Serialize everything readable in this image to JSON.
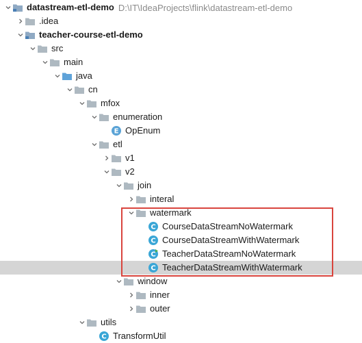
{
  "project": {
    "title": "datastream-etl-demo",
    "path": "D:\\IT\\IdeaProjects\\flink\\datastream-etl-demo"
  },
  "colors": {
    "folder": "#aeb9c1",
    "folder_module": "#8fa9c3",
    "source_folder": "#5fa3d9",
    "class_badge": "#3aa6d6",
    "enum_badge": "#5aa3d6",
    "selection": "#d5d5d5",
    "highlight_border": "#d9443d"
  },
  "tree": [
    {
      "name": "node-datastream-etl-demo",
      "label": "datastream-etl-demo",
      "bold": true,
      "path": "D:\\IT\\IdeaProjects\\flink\\datastream-etl-demo",
      "arrow": "down",
      "icon": "module-folder-icon",
      "indent": 0
    },
    {
      "name": "node-idea",
      "label": ".idea",
      "arrow": "right",
      "icon": "folder-icon",
      "indent": 1
    },
    {
      "name": "node-teacher-course-etl-demo",
      "label": "teacher-course-etl-demo",
      "bold": true,
      "arrow": "down",
      "icon": "module-folder-icon",
      "indent": 1
    },
    {
      "name": "node-src",
      "label": "src",
      "arrow": "down",
      "icon": "folder-icon",
      "indent": 2
    },
    {
      "name": "node-main",
      "label": "main",
      "arrow": "down",
      "icon": "folder-icon",
      "indent": 3
    },
    {
      "name": "node-java",
      "label": "java",
      "arrow": "down",
      "icon": "source-folder-icon",
      "indent": 4
    },
    {
      "name": "node-cn",
      "label": "cn",
      "arrow": "down",
      "icon": "package-icon",
      "indent": 5
    },
    {
      "name": "node-mfox",
      "label": "mfox",
      "arrow": "down",
      "icon": "package-icon",
      "indent": 6
    },
    {
      "name": "node-enumeration",
      "label": "enumeration",
      "arrow": "down",
      "icon": "package-icon",
      "indent": 7
    },
    {
      "name": "node-openum",
      "label": "OpEnum",
      "arrow": "none",
      "icon": "enum-icon",
      "indent": 8
    },
    {
      "name": "node-etl",
      "label": "etl",
      "arrow": "down",
      "icon": "package-icon",
      "indent": 7
    },
    {
      "name": "node-v1",
      "label": "v1",
      "arrow": "right",
      "icon": "package-icon",
      "indent": 8
    },
    {
      "name": "node-v2",
      "label": "v2",
      "arrow": "down",
      "icon": "package-icon",
      "indent": 8
    },
    {
      "name": "node-join",
      "label": "join",
      "arrow": "down",
      "icon": "package-icon",
      "indent": 9
    },
    {
      "name": "node-interal",
      "label": "interal",
      "arrow": "right",
      "icon": "package-icon",
      "indent": 10
    },
    {
      "name": "node-watermark",
      "label": "watermark",
      "arrow": "down",
      "icon": "package-icon",
      "indent": 10
    },
    {
      "name": "node-course-no-watermark",
      "label": "CourseDataStreamNoWatermark",
      "arrow": "none",
      "icon": "class-icon",
      "indent": 11
    },
    {
      "name": "node-course-with-watermark",
      "label": "CourseDataStreamWithWatermark",
      "arrow": "none",
      "icon": "class-icon",
      "indent": 11
    },
    {
      "name": "node-teacher-no-watermark",
      "label": "TeacherDataStreamNoWatermark",
      "arrow": "none",
      "icon": "runnable-class-icon",
      "indent": 11
    },
    {
      "name": "node-teacher-with-watermark",
      "label": "TeacherDataStreamWithWatermark",
      "arrow": "none",
      "icon": "class-icon",
      "indent": 11,
      "selected": true
    },
    {
      "name": "node-window",
      "label": "window",
      "arrow": "down",
      "icon": "package-icon",
      "indent": 9
    },
    {
      "name": "node-inner",
      "label": "inner",
      "arrow": "right",
      "icon": "package-icon",
      "indent": 10
    },
    {
      "name": "node-outer",
      "label": "outer",
      "arrow": "right",
      "icon": "package-icon",
      "indent": 10
    },
    {
      "name": "node-utils",
      "label": "utils",
      "arrow": "down",
      "icon": "package-icon",
      "indent": 6
    },
    {
      "name": "node-transformutil",
      "label": "TransformUtil",
      "arrow": "none",
      "icon": "class-icon",
      "indent": 7
    }
  ]
}
